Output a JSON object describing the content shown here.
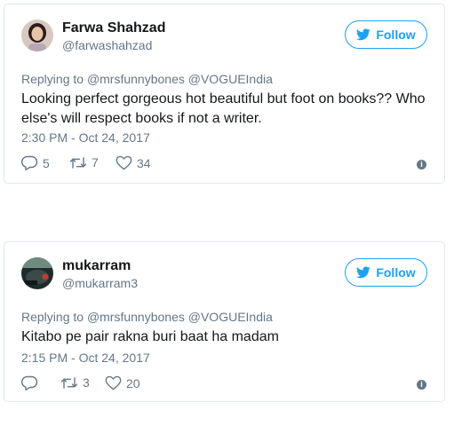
{
  "colors": {
    "accent": "#1da1f2",
    "secondary_text": "#657786",
    "primary_text": "#14171a",
    "border": "#e1e8ed"
  },
  "tweets": [
    {
      "author_name": "Farwa Shahzad",
      "handle": "@farwashahzad",
      "follow_label": "Follow",
      "replying_prefix": "Replying to",
      "mentions": "@mrsfunnybones @VOGUEIndia",
      "text": "Looking perfect gorgeous hot beautiful but foot on books?? Who else's will respect books if not a writer.",
      "timestamp": "2:30 PM - Oct 24, 2017",
      "reply_count": "5",
      "retweet_count": "7",
      "like_count": "34",
      "icons": [
        "speech-bubble-icon",
        "retweet-icon",
        "heart-icon",
        "info-icon"
      ]
    },
    {
      "author_name": "mukarram",
      "handle": "@mukarram3",
      "follow_label": "Follow",
      "replying_prefix": "Replying to",
      "mentions": "@mrsfunnybones @VOGUEIndia",
      "text": "Kitabo pe pair rakna buri baat ha madam",
      "timestamp": "2:15 PM - Oct 24, 2017",
      "reply_count": "",
      "retweet_count": "3",
      "like_count": "20",
      "icons": [
        "speech-bubble-icon",
        "retweet-icon",
        "heart-icon",
        "info-icon"
      ]
    }
  ]
}
